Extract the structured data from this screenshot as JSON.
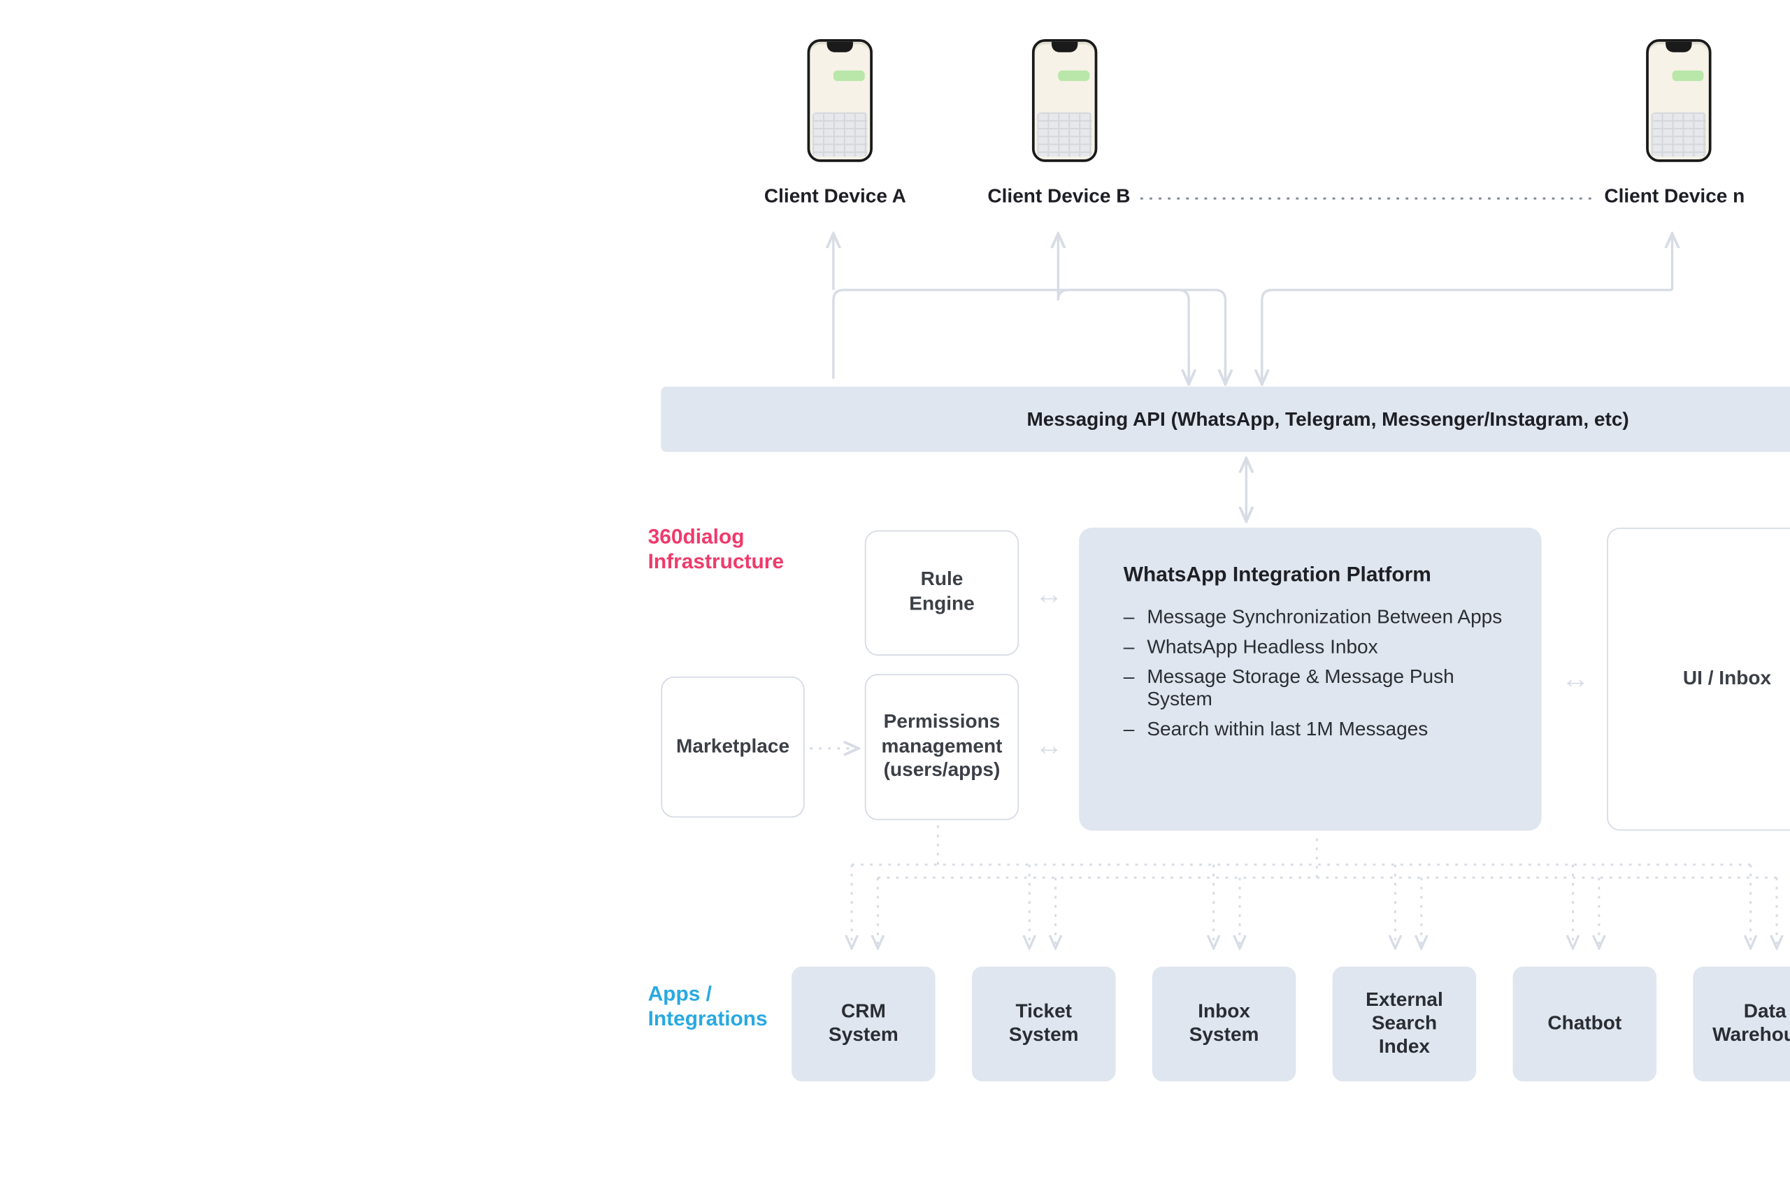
{
  "devices": {
    "a": "Client Device A",
    "b": "Client Device B",
    "n": "Client Device n"
  },
  "api_bar": "Messaging API (WhatsApp, Telegram, Messenger/Instagram, etc)",
  "section_titles": {
    "infra_l1": "360dialog",
    "infra_l2": "Infrastructure",
    "apps_l1": "Apps /",
    "apps_l2": "Integrations"
  },
  "infra": {
    "rule_engine_l1": "Rule",
    "rule_engine_l2": "Engine",
    "perm_l1": "Permissions",
    "perm_l2": "management",
    "perm_l3": "(users/apps)",
    "marketplace": "Marketplace",
    "ui_inbox": "UI / Inbox",
    "wip_title": "WhatsApp Integration Platform",
    "wip_items": [
      "Message Synchronization Between Apps",
      "WhatsApp Headless Inbox",
      "Message Storage & Message Push System",
      "Search within last 1M Messages"
    ]
  },
  "apps": {
    "crm_l1": "CRM",
    "crm_l2": "System",
    "ticket_l1": "Ticket",
    "ticket_l2": "System",
    "inbox_l1": "Inbox",
    "inbox_l2": "System",
    "search_l1": "External",
    "search_l2": "Search",
    "search_l3": "Index",
    "chatbot": "Chatbot",
    "dw_l1": "Data",
    "dw_l2": "Warehouse"
  }
}
